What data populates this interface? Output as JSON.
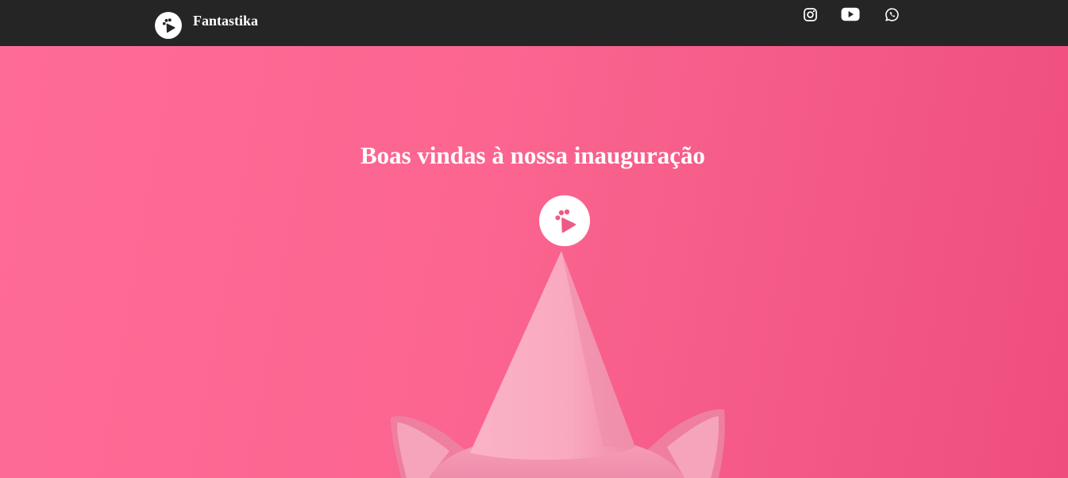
{
  "navbar": {
    "brand_name": "Fantastika",
    "logo_icon": "paw-play-icon",
    "social": [
      {
        "name": "instagram",
        "icon": "instagram-icon"
      },
      {
        "name": "youtube",
        "icon": "youtube-icon"
      },
      {
        "name": "whatsapp",
        "icon": "whatsapp-icon"
      }
    ]
  },
  "hero": {
    "title": "Boas vindas à nossa inauguração",
    "logo_icon": "paw-play-icon",
    "image": "dog-with-party-hat"
  },
  "colors": {
    "navbar_bg": "#252525",
    "hero_pink": "#fb6590",
    "hero_pink_dark": "#ee4e7e",
    "logo_bg": "#ffffff",
    "accent_pink": "#ee5a85"
  }
}
